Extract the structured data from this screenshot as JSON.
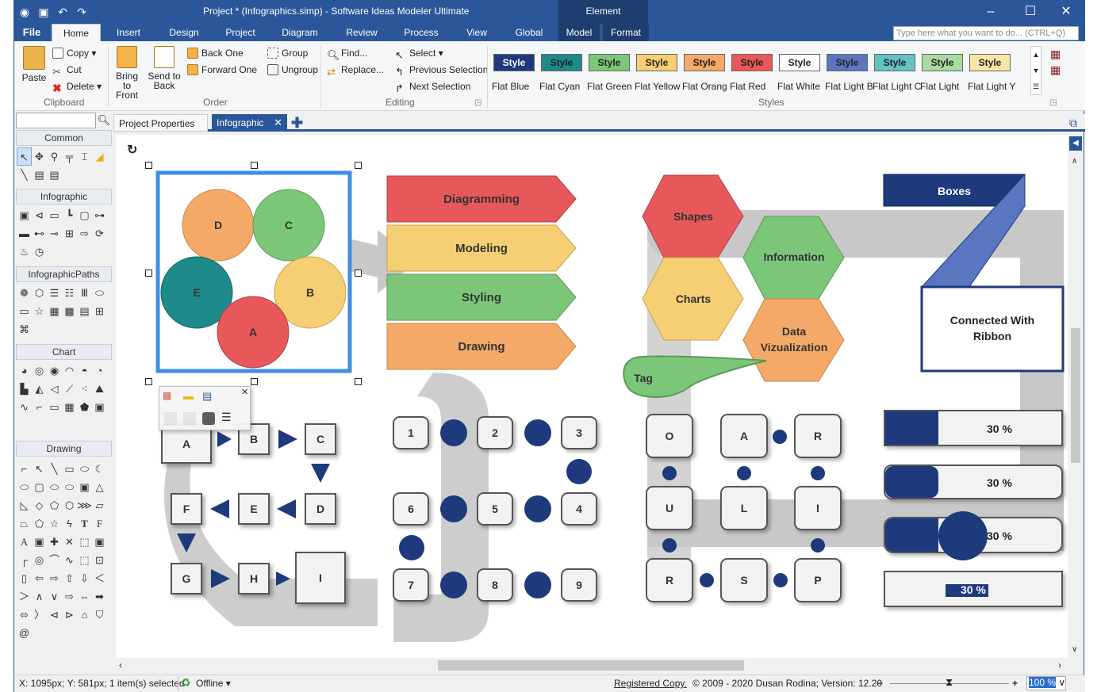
{
  "titlebar": {
    "title": "Project * (Infographics.simp) - Software Ideas Modeler Ultimate",
    "context_tab": "Element"
  },
  "tabs": [
    "File",
    "Home",
    "Insert",
    "Design",
    "Project",
    "Diagram",
    "Review",
    "Process",
    "View",
    "Global",
    "Model",
    "Format"
  ],
  "tell_me_placeholder": "Type here what you want to do... (CTRL+Q)",
  "ribbon": {
    "clipboard": {
      "paste": "Paste",
      "copy": "Copy",
      "cut": "Cut",
      "delete": "Delete",
      "label": "Clipboard"
    },
    "order": {
      "bring_front": "Bring to Front",
      "send_back": "Send to Back",
      "back_one": "Back One",
      "forward_one": "Forward One",
      "group": "Group",
      "ungroup": "Ungroup",
      "label": "Order"
    },
    "editing": {
      "find": "Find...",
      "replace": "Replace...",
      "select": "Select",
      "prev_sel": "Previous Selection",
      "next_sel": "Next Selection",
      "label": "Editing"
    },
    "styles": {
      "swatch_text": "Style",
      "label": "Styles",
      "items": [
        {
          "name": "Flat Blue",
          "bg": "#1e3a7d",
          "fg": "#ffffff"
        },
        {
          "name": "Flat Cyan",
          "bg": "#1e8a8a",
          "fg": "#222222"
        },
        {
          "name": "Flat Green",
          "bg": "#7cc67a",
          "fg": "#222222"
        },
        {
          "name": "Flat Yellow",
          "bg": "#f6cf74",
          "fg": "#222222"
        },
        {
          "name": "Flat Orang",
          "bg": "#f4a968",
          "fg": "#222222"
        },
        {
          "name": "Flat Red",
          "bg": "#e8585a",
          "fg": "#222222"
        },
        {
          "name": "Flat White",
          "bg": "#ffffff",
          "fg": "#222222"
        },
        {
          "name": "Flat Light B",
          "bg": "#5a76c0",
          "fg": "#222222"
        },
        {
          "name": "Flat Light C",
          "bg": "#62c2c4",
          "fg": "#222222"
        },
        {
          "name": "Flat Light",
          "bg": "#a8dc9f",
          "fg": "#222222"
        },
        {
          "name": "Flat Light Y",
          "bg": "#fae5a6",
          "fg": "#222222"
        }
      ]
    }
  },
  "toolbox": {
    "sections": [
      "Common",
      "Infographic",
      "InfographicPaths",
      "Chart",
      "Drawing"
    ]
  },
  "doc_tabs": [
    "Project Properties",
    "Infographic"
  ],
  "diagram": {
    "circles": [
      "D",
      "C",
      "E",
      "B",
      "A"
    ],
    "arrows": [
      "Diagramming",
      "Modeling",
      "Styling",
      "Drawing"
    ],
    "hexes": [
      "Shapes",
      "Information",
      "Charts",
      "Data Vizualization"
    ],
    "tag": "Tag",
    "boxes_header": "Boxes",
    "ribbon_text": "Connected With Ribbon",
    "letter_boxes": [
      "A",
      "B",
      "C",
      "F",
      "E",
      "D",
      "G",
      "H",
      "I"
    ],
    "numbers": [
      "1",
      "2",
      "3",
      "6",
      "5",
      "4",
      "7",
      "8",
      "9"
    ],
    "word_boxes": [
      "O",
      "A",
      "R",
      "U",
      "L",
      "I",
      "R",
      "S",
      "P"
    ],
    "progress": [
      {
        "label": "30 %",
        "value": 0.3
      },
      {
        "label": "30 %",
        "value": 0.3
      },
      {
        "label": "30 %",
        "value": 0.3
      },
      {
        "label": "30 %",
        "value": 0.3
      }
    ]
  },
  "status": {
    "coords": "X: 1095px; Y: 581px; 1 item(s) selected",
    "offline": "Offline",
    "registered": "Registered Copy.",
    "copyright": "© 2009 - 2020 Dusan Rodina; Version: 12.20",
    "zoom": "100 %"
  }
}
